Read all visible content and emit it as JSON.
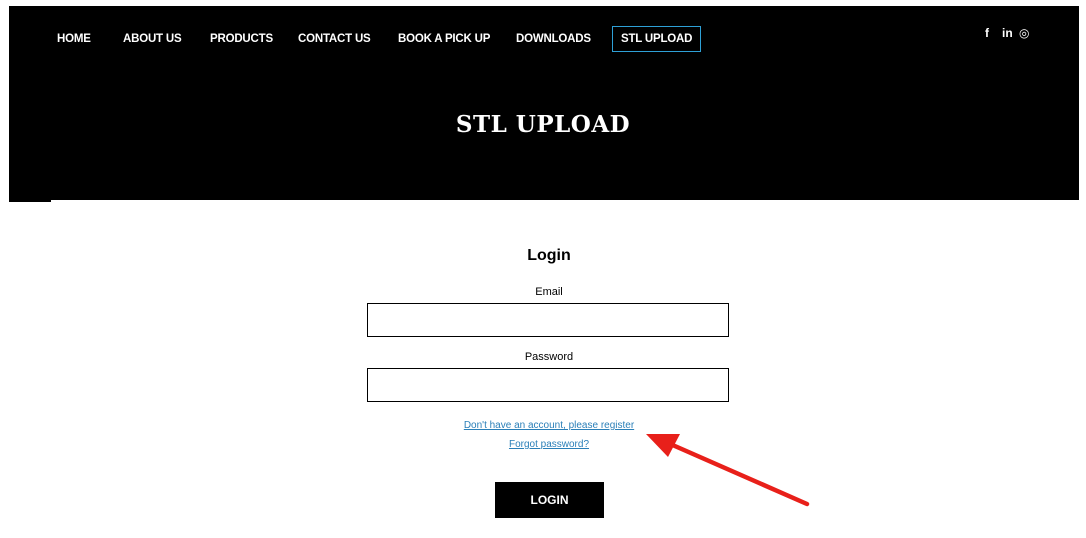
{
  "nav": {
    "items": [
      {
        "label": "HOME"
      },
      {
        "label": "ABOUT US"
      },
      {
        "label": "PRODUCTS"
      },
      {
        "label": "CONTACT US"
      },
      {
        "label": "BOOK A PICK UP"
      },
      {
        "label": "DOWNLOADS"
      },
      {
        "label": "STL UPLOAD",
        "active": true
      }
    ],
    "social": {
      "facebook": "f",
      "linkedin": "in",
      "instagram": "◎"
    }
  },
  "hero": {
    "title": "STL UPLOAD"
  },
  "login": {
    "title": "Login",
    "email_label": "Email",
    "email_value": "",
    "password_label": "Password",
    "password_value": "",
    "register_link": "Don't have an account, please register",
    "forgot_link": "Forgot password?",
    "button": "LOGIN"
  },
  "colors": {
    "accent": "#2ea0d6",
    "link": "#2a7fb8",
    "annotation_arrow": "#e8201a"
  },
  "icons": [
    "facebook-icon",
    "linkedin-icon",
    "instagram-icon",
    "annotation-arrow"
  ]
}
